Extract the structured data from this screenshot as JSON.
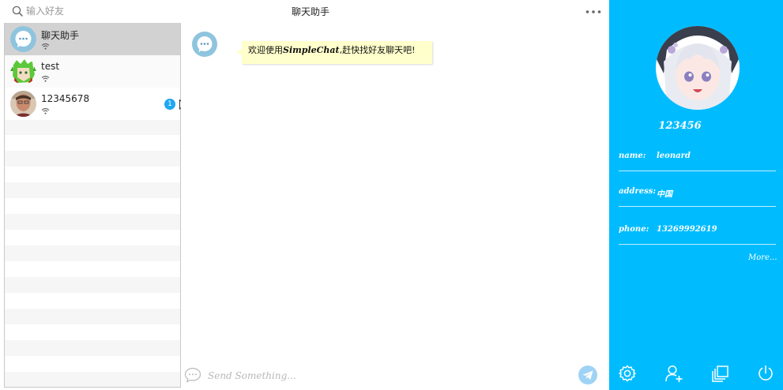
{
  "search": {
    "placeholder": "输入好友"
  },
  "contacts": [
    {
      "name": "聊天助手",
      "selected": true
    },
    {
      "name": "test",
      "selected": false
    },
    {
      "name": "12345678",
      "selected": false,
      "unread": "1"
    }
  ],
  "chat": {
    "title": "聊天助手",
    "message": {
      "prefix": "欢迎使用",
      "brand": "SimpleChat",
      "suffix": ",赶快找好友聊天吧!"
    },
    "input_placeholder": "Send Something..."
  },
  "profile": {
    "id": "123456",
    "fields": [
      {
        "key": "name:",
        "value": "leonard"
      },
      {
        "key": "address:",
        "value": "中国"
      },
      {
        "key": "phone:",
        "value": "13269992619"
      }
    ],
    "more": "More..."
  },
  "icons": {
    "search": "search-icon",
    "more": "more-dots-icon",
    "send": "send-plane-icon",
    "bottom_bar": [
      "settings-gear-icon",
      "add-user-icon",
      "layers-icon",
      "power-icon"
    ]
  },
  "colors": {
    "accent": "#00bcff",
    "bubble": "#ffffcc",
    "badge": "#1ea7f4"
  }
}
